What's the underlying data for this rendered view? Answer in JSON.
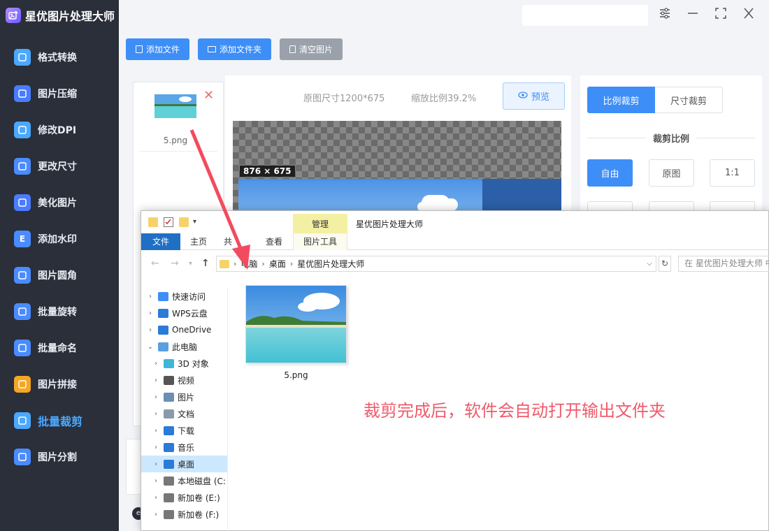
{
  "app": {
    "title": "星优图片处理大师",
    "logo_icon": "image-edit-icon"
  },
  "sidebar": {
    "items": [
      {
        "label": "格式转换",
        "icon": "format-convert-icon",
        "color": "#4aa8ff"
      },
      {
        "label": "图片压缩",
        "icon": "image-compress-icon",
        "color": "#4a7cff"
      },
      {
        "label": "修改DPI",
        "icon": "dpi-icon",
        "color": "#4aa8ff"
      },
      {
        "label": "更改尺寸",
        "icon": "resize-icon",
        "color": "#4a8cff"
      },
      {
        "label": "美化图片",
        "icon": "beautify-icon",
        "color": "#4a7cff"
      },
      {
        "label": "添加水印",
        "icon": "watermark-icon",
        "color": "#4a8cff",
        "glyph": "E"
      },
      {
        "label": "图片圆角",
        "icon": "round-corner-icon",
        "color": "#4a8cff"
      },
      {
        "label": "批量旋转",
        "icon": "rotate-icon",
        "color": "#4a8cff"
      },
      {
        "label": "批量命名",
        "icon": "rename-icon",
        "color": "#4a8cff"
      },
      {
        "label": "图片拼接",
        "icon": "stitch-icon",
        "color": "#f5a623"
      },
      {
        "label": "批量裁剪",
        "icon": "crop-icon",
        "color": "#4aa8ff",
        "active": true
      },
      {
        "label": "图片分割",
        "icon": "split-icon",
        "color": "#4a8cff"
      }
    ]
  },
  "titlebar": {
    "settings_icon": "sliders-icon",
    "minimize_icon": "minimize-icon",
    "maximize_icon": "maximize-icon",
    "close_icon": "close-icon"
  },
  "toolbar": {
    "add_file": "添加文件",
    "add_folder": "添加文件夹",
    "clear": "清空图片"
  },
  "filelist": {
    "items": [
      {
        "name": "5.png"
      }
    ],
    "remove_glyph": "✕"
  },
  "preview": {
    "original_size": "原图尺寸1200*675",
    "zoom": "缩放比例39.2%",
    "preview_button": "预览",
    "crop_size_label": "876 × 675"
  },
  "crop_panel": {
    "tab_ratio": "比例裁剪",
    "tab_size": "尺寸裁剪",
    "section_title": "裁剪比例",
    "ratios": [
      "自由",
      "原图",
      "1:1"
    ],
    "active_ratio": "自由"
  },
  "explorer": {
    "manage_tab": "管理",
    "window_title": "星优图片处理大师",
    "tabs": {
      "file": "文件",
      "home": "主页",
      "share": "共",
      "view": "查看",
      "picture_tools": "图片工具"
    },
    "address": {
      "segments": [
        "电脑",
        "桌面",
        "星优图片处理大师"
      ],
      "search_placeholder": "在 星优图片处理大师 中"
    },
    "tree": [
      {
        "label": "快速访问",
        "icon": "star-icon",
        "color": "#3e8ef7",
        "level": 0
      },
      {
        "label": "WPS云盘",
        "icon": "cloud-icon",
        "color": "#2b7bd8",
        "level": 0
      },
      {
        "label": "OneDrive",
        "icon": "onedrive-icon",
        "color": "#2b7bd8",
        "level": 0
      },
      {
        "label": "此电脑",
        "icon": "computer-icon",
        "color": "#5aa0e0",
        "level": 0,
        "expanded": true
      },
      {
        "label": "3D 对象",
        "icon": "3d-objects-icon",
        "color": "#3fb5d9",
        "level": 1
      },
      {
        "label": "视频",
        "icon": "video-icon",
        "color": "#555",
        "level": 1
      },
      {
        "label": "图片",
        "icon": "pictures-icon",
        "color": "#6b8fb3",
        "level": 1
      },
      {
        "label": "文档",
        "icon": "documents-icon",
        "color": "#8a9aaa",
        "level": 1
      },
      {
        "label": "下载",
        "icon": "download-icon",
        "color": "#2b7bd8",
        "level": 1
      },
      {
        "label": "音乐",
        "icon": "music-icon",
        "color": "#2b7bd8",
        "level": 1
      },
      {
        "label": "桌面",
        "icon": "desktop-icon",
        "color": "#2b7bd8",
        "level": 1,
        "selected": true
      },
      {
        "label": "本地磁盘 (C:",
        "icon": "drive-icon",
        "color": "#777",
        "level": 1
      },
      {
        "label": "新加卷 (E:)",
        "icon": "drive-icon",
        "color": "#777",
        "level": 1
      },
      {
        "label": "新加卷 (F:)",
        "icon": "drive-icon",
        "color": "#777",
        "level": 1
      }
    ],
    "files": [
      {
        "name": "5.png"
      }
    ],
    "callout": "裁剪完成后，软件会自动打开输出文件夹"
  },
  "annotation": {
    "arrow_color": "#f24b5f"
  }
}
